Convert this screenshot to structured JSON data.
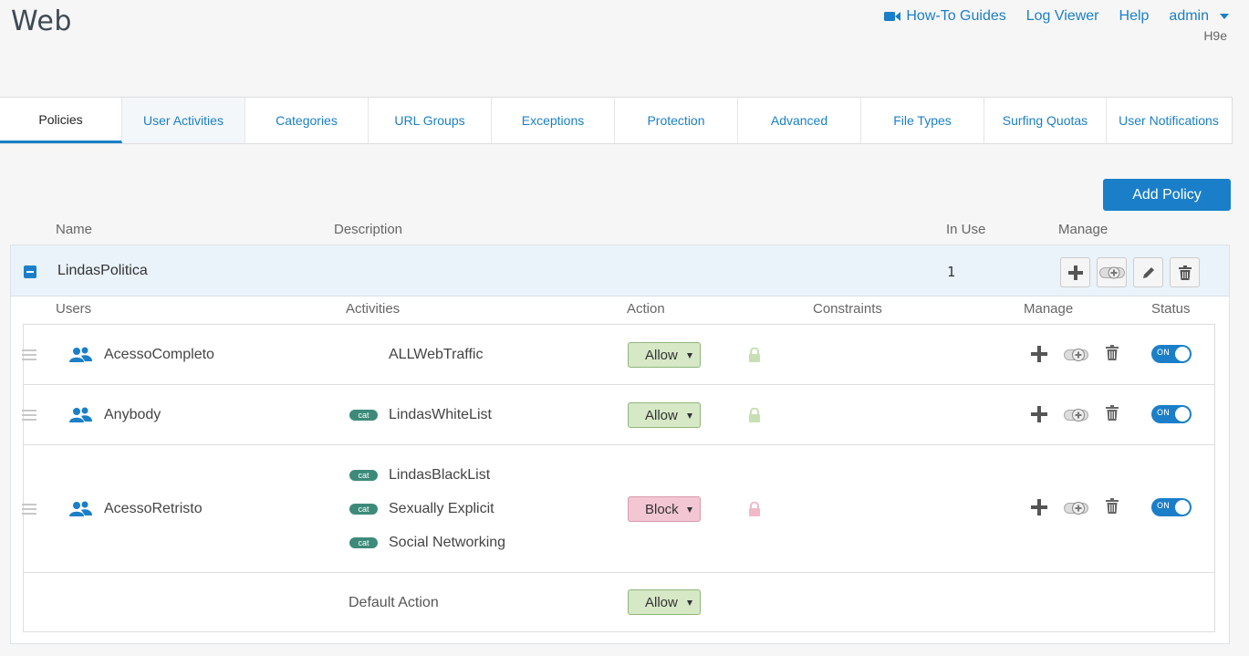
{
  "page": {
    "title": "Web"
  },
  "topnav": {
    "howto": "How-To Guides",
    "logviewer": "Log Viewer",
    "help": "Help",
    "user": "admin",
    "device": "H9e"
  },
  "tabs": [
    "Policies",
    "User Activities",
    "Categories",
    "URL Groups",
    "Exceptions",
    "Protection",
    "Advanced",
    "File Types",
    "Surfing Quotas",
    "User Notifications"
  ],
  "toolbar": {
    "add_policy": "Add Policy"
  },
  "table_headers": {
    "name": "Name",
    "description": "Description",
    "in_use": "In Use",
    "manage": "Manage"
  },
  "policy": {
    "name": "LindasPolitica",
    "in_use": "1"
  },
  "rule_headers": {
    "users": "Users",
    "activities": "Activities",
    "action": "Action",
    "constraints": "Constraints",
    "manage": "Manage",
    "status": "Status"
  },
  "rules": [
    {
      "user": "AcessoCompleto",
      "activities": [
        {
          "badge": "",
          "name": "ALLWebTraffic"
        }
      ],
      "action": "Allow",
      "status": "ON"
    },
    {
      "user": "Anybody",
      "activities": [
        {
          "badge": "cat",
          "name": "LindasWhiteList"
        }
      ],
      "action": "Allow",
      "status": "ON"
    },
    {
      "user": "AcessoRetristo",
      "activities": [
        {
          "badge": "cat",
          "name": "LindasBlackList"
        },
        {
          "badge": "cat",
          "name": "Sexually Explicit"
        },
        {
          "badge": "cat",
          "name": "Social Networking"
        }
      ],
      "action": "Block",
      "status": "ON"
    }
  ],
  "default_action": {
    "label": "Default Action",
    "value": "Allow"
  },
  "colors": {
    "accent": "#1a7fc8",
    "allow": "#d6e8c6",
    "block": "#f3c6d3",
    "badge": "#3d8a7a"
  }
}
